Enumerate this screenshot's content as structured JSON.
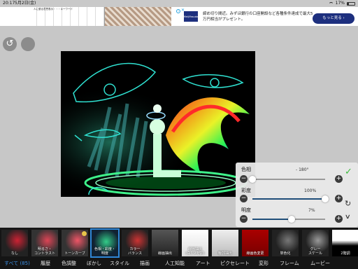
{
  "status": {
    "time": "20:17",
    "date": "5月2日(金)",
    "battery": "17%"
  },
  "ad": {
    "manga_caption": "人に優る意思表示・・・キーワード",
    "logo": "MeijiYasuda",
    "text": "締め切り間近。みずほ銀行の口座開設など各種条件達成で最大5万円相当がプレゼント。",
    "cta": "もっと見る",
    "info_icon": "info-icon",
    "close_icon": "close-icon"
  },
  "toolbar": {
    "undo_icon": "undo-icon",
    "redo_icon": "redo-icon"
  },
  "adjust": {
    "hue_label": "色相",
    "hue_value": "- 180°",
    "hue_level": 0.0,
    "saturation_label": "彩度",
    "saturation_value": "100%",
    "saturation_level": 1.0,
    "brightness_label": "明度",
    "brightness_value": "7%",
    "brightness_level": 0.535,
    "minus": "−",
    "plus": "+",
    "apply_icon": "check-icon",
    "reset_icon": "reset-icon",
    "collapse_icon": "chevron-down-icon",
    "accent_color": "#1f4e79"
  },
  "filters": [
    {
      "label": "なし"
    },
    {
      "label": "明るさ・\nコントラスト"
    },
    {
      "label": "トーンカーブ",
      "premium": true
    },
    {
      "label": "色相・彩度・\n明度",
      "selected": true
    },
    {
      "label": "カラー\nバランス"
    },
    {
      "label": "線画抽出"
    },
    {
      "label": "線画抽出\n(白黒2階調)"
    },
    {
      "label": "輪郭抽出"
    },
    {
      "label": "線画色変更"
    },
    {
      "label": "単色化"
    },
    {
      "label": "グレー\nスケール"
    },
    {
      "label": "2階調"
    }
  ],
  "tabs": [
    {
      "label": "すべて (85)",
      "active": true
    },
    {
      "label": "履歴"
    },
    {
      "label": "色調整"
    },
    {
      "label": "ぼかし"
    },
    {
      "label": "スタイル"
    },
    {
      "label": "描画"
    },
    {
      "label": "人工知能"
    },
    {
      "label": "アート"
    },
    {
      "label": "ピクセレート"
    },
    {
      "label": "変形"
    },
    {
      "label": "フレーム"
    },
    {
      "label": "ムービー"
    }
  ]
}
